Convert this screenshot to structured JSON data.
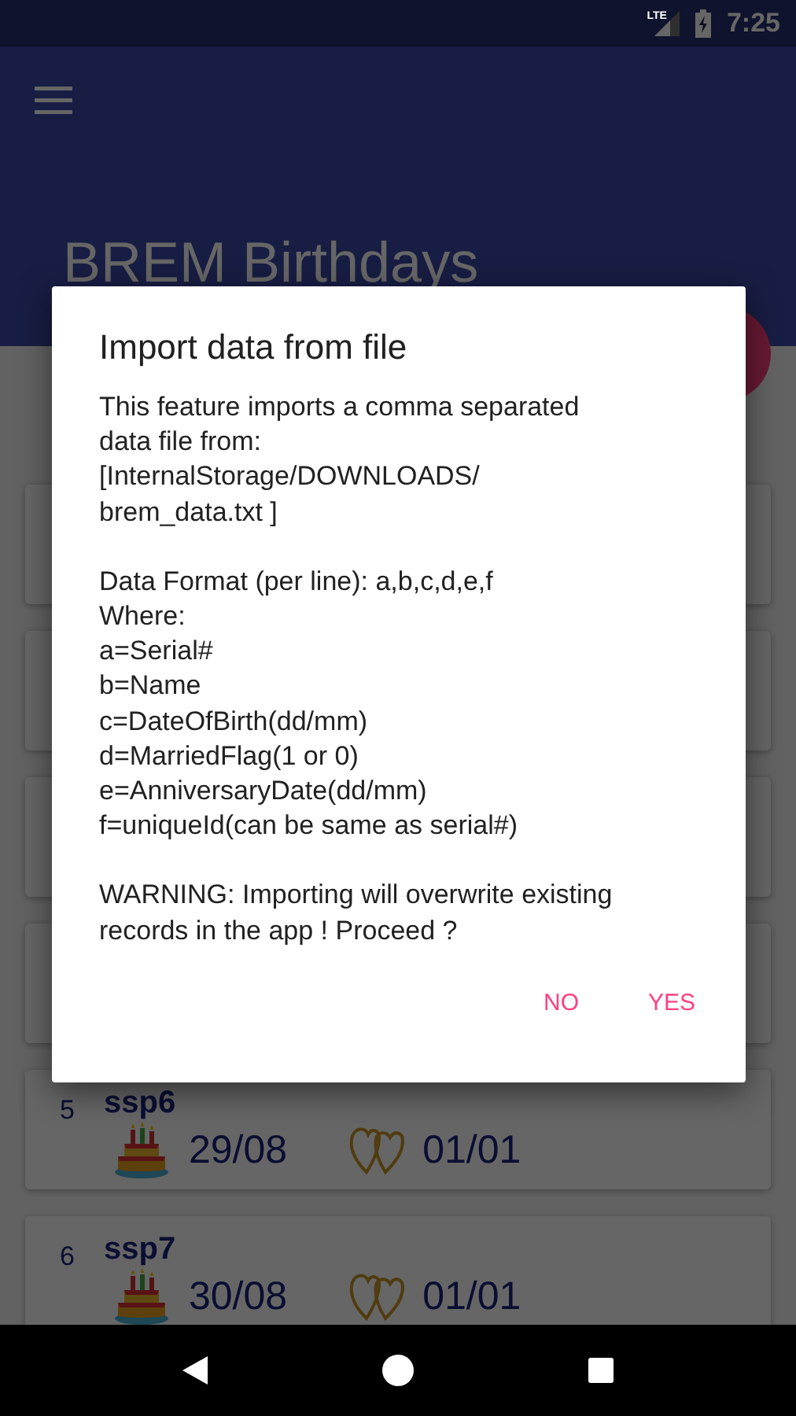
{
  "status_bar": {
    "network": "LTE",
    "time": "7:25"
  },
  "app_bar": {
    "title": "BREM Birthdays"
  },
  "entries": [
    {
      "serial": "5",
      "name": "ssp6",
      "birthday": "29/08",
      "anniversary": "01/01"
    },
    {
      "serial": "6",
      "name": "ssp7",
      "birthday": "30/08",
      "anniversary": "01/01"
    }
  ],
  "dialog": {
    "title": "Import data from file",
    "paragraphs": [
      "This feature imports a comma separated\ndata file from:\n[InternalStorage/DOWNLOADS/\nbrem_data.txt ]",
      "Data Format (per line): a,b,c,d,e,f\nWhere:\na=Serial#\nb=Name\nc=DateOfBirth(dd/mm)\nd=MarriedFlag(1 or 0)\ne=AnniversaryDate(dd/mm)\nf=uniqueId(can be same as serial#)",
      "WARNING: Importing will overwrite existing\nrecords in the app ! Proceed ?"
    ],
    "buttons": [
      "NO",
      "YES"
    ]
  }
}
